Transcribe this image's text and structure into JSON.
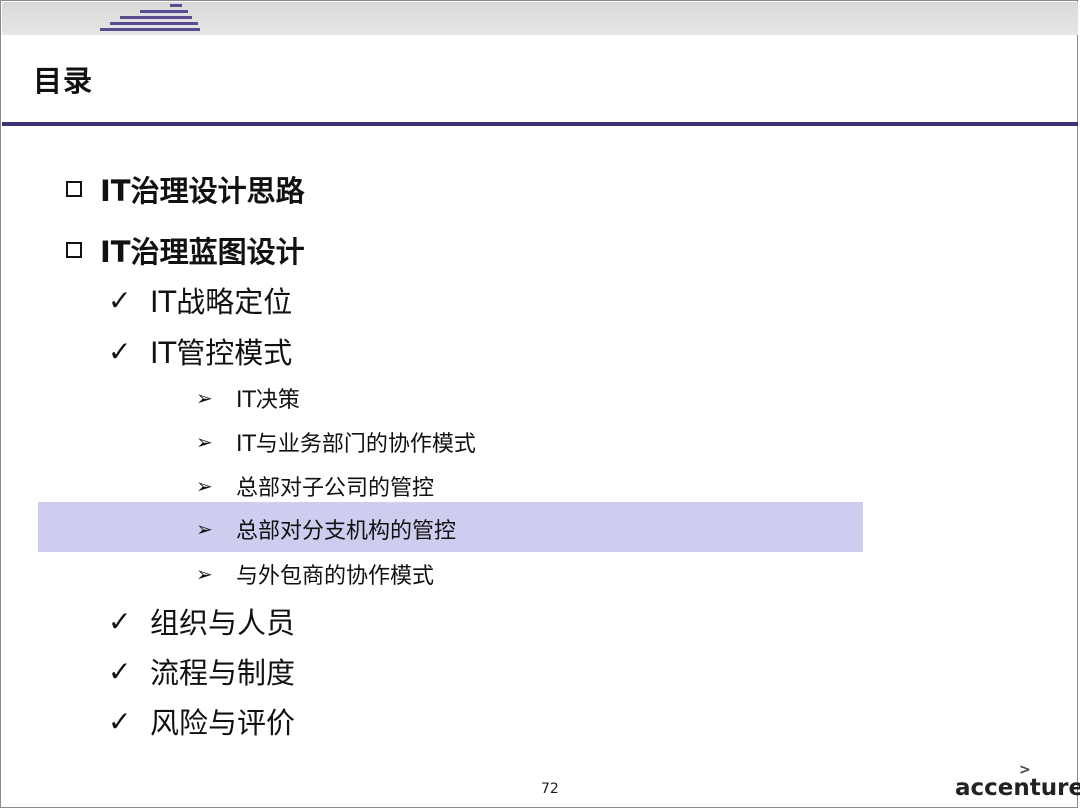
{
  "slide": {
    "title": "目录",
    "page_number": "72",
    "logo_text": "accenture",
    "colors": {
      "accent": "#3d3478",
      "highlight": "#cfcdef",
      "header_band": "#dcdcdc"
    }
  },
  "items": [
    {
      "level": 1,
      "marker": "□",
      "text": "IT治理设计思路"
    },
    {
      "level": 1,
      "marker": "□",
      "text": "IT治理蓝图设计"
    },
    {
      "level": 2,
      "marker": "✓",
      "text": "IT战略定位"
    },
    {
      "level": 2,
      "marker": "✓",
      "text": "IT管控模式"
    },
    {
      "level": 3,
      "marker": "➢",
      "text": "IT决策"
    },
    {
      "level": 3,
      "marker": "➢",
      "text": "IT与业务部门的协作模式"
    },
    {
      "level": 3,
      "marker": "➢",
      "text": "总部对子公司的管控"
    },
    {
      "level": 3,
      "marker": "➢",
      "text": "总部对分支机构的管控",
      "highlighted": true
    },
    {
      "level": 3,
      "marker": "➢",
      "text": "与外包商的协作模式"
    },
    {
      "level": 2,
      "marker": "✓",
      "text": "组织与人员"
    },
    {
      "level": 2,
      "marker": "✓",
      "text": "流程与制度"
    },
    {
      "level": 2,
      "marker": "✓",
      "text": "风险与评价"
    }
  ]
}
